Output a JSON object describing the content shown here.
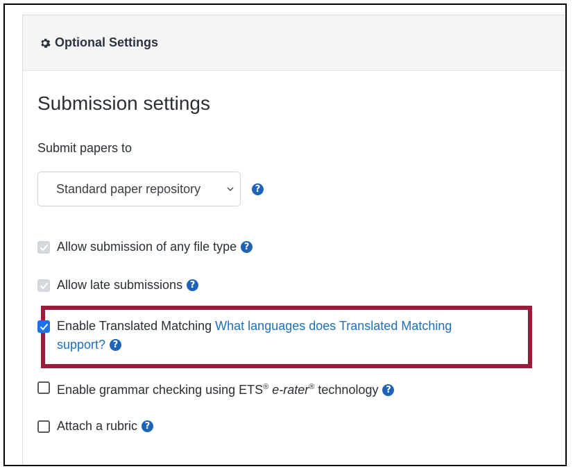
{
  "panel": {
    "title": "Optional Settings",
    "icon": "gear-icon"
  },
  "section": {
    "title": "Submission settings"
  },
  "submit_to": {
    "label": "Submit papers to",
    "selected": "Standard paper repository",
    "help": "?"
  },
  "options": {
    "any_file": {
      "label": "Allow submission of any file type",
      "checked": true,
      "disabled": true
    },
    "late": {
      "label": "Allow late submissions",
      "checked": true,
      "disabled": true
    },
    "translated": {
      "label": "Enable Translated Matching",
      "link": "What languages does Translated Matching support?",
      "checked": true
    },
    "grammar": {
      "label_pre": "Enable grammar checking using ETS",
      "reg": "®",
      "label_em": "e-rater",
      "label_post": "technology",
      "checked": false
    },
    "rubric": {
      "label": "Attach a rubric",
      "checked": false
    }
  },
  "help_glyph": "?",
  "colors": {
    "highlight": "#9b1c3a",
    "link": "#1f6fb8",
    "help_icon": "#1f63b8",
    "checkbox_checked": "#1a73e8"
  }
}
